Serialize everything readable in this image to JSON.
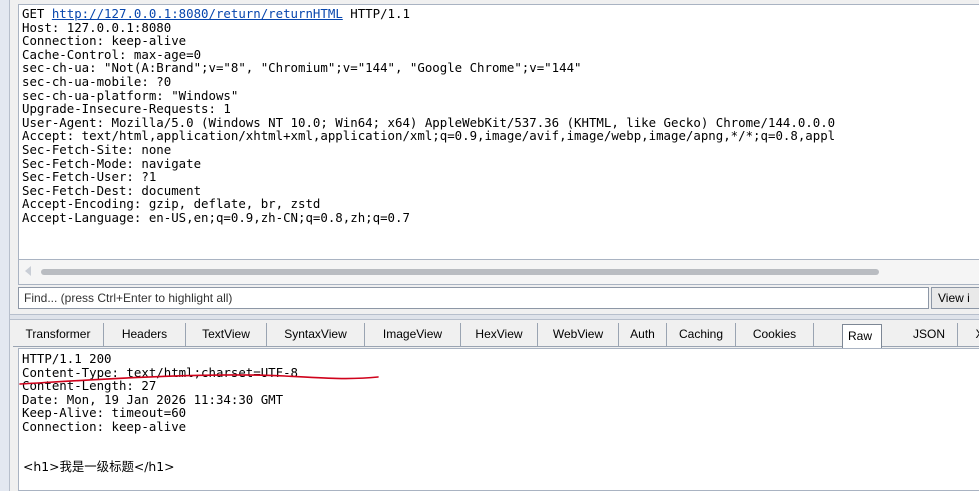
{
  "request": {
    "method_prefix": "GET ",
    "url": "http://127.0.0.1:8080/return/returnHTML",
    "protocol_suffix": " HTTP/1.1",
    "headers": [
      "Host: 127.0.0.1:8080",
      "Connection: keep-alive",
      "Cache-Control: max-age=0",
      "sec-ch-ua: \"Not(A:Brand\";v=\"8\", \"Chromium\";v=\"144\", \"Google Chrome\";v=\"144\"",
      "sec-ch-ua-mobile: ?0",
      "sec-ch-ua-platform: \"Windows\"",
      "Upgrade-Insecure-Requests: 1",
      "User-Agent: Mozilla/5.0 (Windows NT 10.0; Win64; x64) AppleWebKit/537.36 (KHTML, like Gecko) Chrome/144.0.0.0",
      "Accept: text/html,application/xhtml+xml,application/xml;q=0.9,image/avif,image/webp,image/apng,*/*;q=0.8,appl",
      "Sec-Fetch-Site: none",
      "Sec-Fetch-Mode: navigate",
      "Sec-Fetch-User: ?1",
      "Sec-Fetch-Dest: document",
      "Accept-Encoding: gzip, deflate, br, zstd",
      "Accept-Language: en-US,en;q=0.9,zh-CN;q=0.8,zh;q=0.7"
    ]
  },
  "find_bar": {
    "placeholder": "Find... (press Ctrl+Enter to highlight all)",
    "view_button_label": "View i"
  },
  "tabs": [
    {
      "label": "Transformer",
      "name": "tab-transformer"
    },
    {
      "label": "Headers",
      "name": "tab-headers"
    },
    {
      "label": "TextView",
      "name": "tab-textview"
    },
    {
      "label": "SyntaxView",
      "name": "tab-syntaxview"
    },
    {
      "label": "ImageView",
      "name": "tab-imageview"
    },
    {
      "label": "HexView",
      "name": "tab-hexview"
    },
    {
      "label": "WebView",
      "name": "tab-webview"
    },
    {
      "label": "Auth",
      "name": "tab-auth"
    },
    {
      "label": "Caching",
      "name": "tab-caching"
    },
    {
      "label": "Cookies",
      "name": "tab-cookies"
    },
    {
      "label": "Raw",
      "name": "tab-raw",
      "active": true
    },
    {
      "label": "JSON",
      "name": "tab-json"
    },
    {
      "label": "X",
      "name": "tab-xml"
    }
  ],
  "response": {
    "lines": [
      "HTTP/1.1 200",
      "Content-Type: text/html;charset=UTF-8",
      "Content-Length: 27",
      "Date: Mon, 19 Jan 2026 11:34:30 GMT",
      "Keep-Alive: timeout=60",
      "Connection: keep-alive"
    ],
    "body": "<h1>我是一级标题</h1>"
  },
  "colors": {
    "link": "#0645ad",
    "annotation": "#d0021b",
    "active_tab": "#ffffff"
  }
}
